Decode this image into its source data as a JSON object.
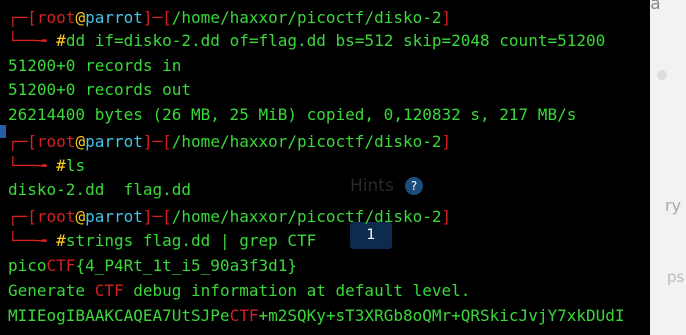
{
  "background": {
    "search_label": "Sea",
    "hints_label": "Hints",
    "hints_icon": "?",
    "hint_number": "1",
    "side_text_1": "ry",
    "side_text_2": "ps"
  },
  "terminal": {
    "user": "root",
    "at": "@",
    "host": "parrot",
    "cwd": "/home/haxxor/picoctf/disko-2",
    "prompt_char": "#",
    "commands": [
      "dd if=disko-2.dd of=flag.dd bs=512 skip=2048 count=51200",
      "ls",
      "strings flag.dd | grep CTF"
    ],
    "dd_output": [
      "51200+0 records in",
      "51200+0 records out",
      "26214400 bytes (26 MB, 25 MiB) copied, 0,120832 s, 217 MB/s"
    ],
    "ls_output": "disko-2.dd  flag.dd",
    "grep_results": [
      {
        "before": "pico",
        "match": "CTF",
        "after": "{4_P4Rt_1t_i5_90a3f3d1}"
      },
      {
        "before": "Generate ",
        "match": "CTF",
        "after": " debug information at default level."
      },
      {
        "before": "MIIEogIBAAKCAQEA7UtSJPe",
        "match": "CTF",
        "after": "+m2SQKy+sT3XRGb8oQMr+QRSkicJvjY7xkDUdI"
      }
    ]
  },
  "colors": {
    "prompt_bracket": "#d42020",
    "user": "#d42020",
    "at": "#ffcc1a",
    "host": "#43c3e8",
    "cwd": "#3ad83a",
    "output": "#3ad83a",
    "match": "#d42020"
  }
}
